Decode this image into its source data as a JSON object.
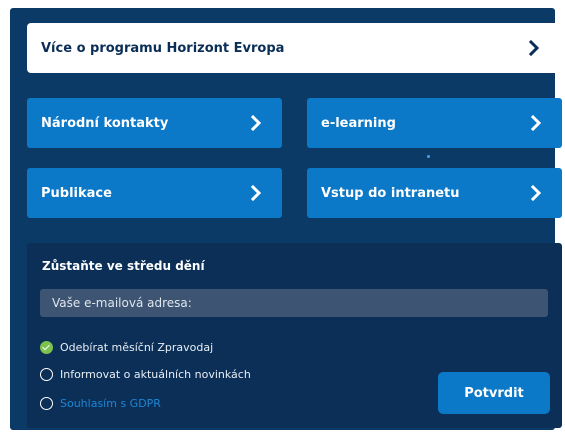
{
  "top_link": {
    "label": "Více o programu Horizont Evropa"
  },
  "tiles": [
    {
      "label": "Národní kontakty"
    },
    {
      "label": "e-learning"
    },
    {
      "label": "Publikace"
    },
    {
      "label": "Vstup do intranetu"
    }
  ],
  "subscribe": {
    "title": "Zůstaňte ve středu dění",
    "email_placeholder": "Vaše e-mailová adresa:",
    "options": [
      {
        "label": "Odebírat měsíční Zpravodaj",
        "checked": true
      },
      {
        "label": "Informovat o aktuálních novinkách",
        "checked": false
      },
      {
        "label": "Souhlasím s GDPR",
        "checked": false
      }
    ],
    "submit_label": "Potvrdit"
  },
  "colors": {
    "panel_bg": "#0b3a66",
    "tile_bg": "#0b78c8",
    "check_green": "#7cc24e",
    "link_blue": "#1e86d6"
  },
  "icons": {
    "chevron": "chevron-right-icon",
    "check": "check-circle-icon",
    "radio": "radio-empty-icon"
  }
}
